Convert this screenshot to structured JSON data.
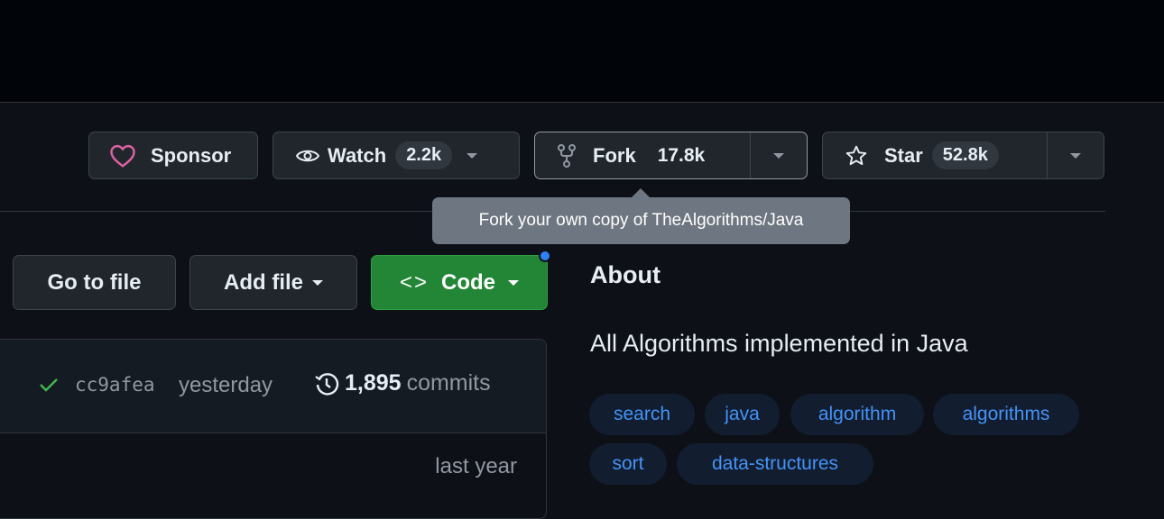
{
  "actions": {
    "sponsor_label": "Sponsor",
    "watch_label": "Watch",
    "watch_count": "2.2k",
    "fork_label": "Fork",
    "fork_count": "17.8k",
    "star_label": "Star",
    "star_count": "52.8k"
  },
  "tooltip": {
    "text": "Fork your own copy of TheAlgorithms/Java"
  },
  "file_actions": {
    "go_to_file": "Go to file",
    "add_file": "Add file",
    "code": "Code"
  },
  "commit": {
    "hash": "cc9afea",
    "time": "yesterday",
    "count": "1,895",
    "commits_label": "commits",
    "row_time": "last year"
  },
  "about": {
    "title": "About",
    "description": "All Algorithms implemented in Java",
    "topics": [
      "search",
      "java",
      "algorithm",
      "algorithms",
      "sort",
      "data-structures"
    ]
  },
  "colors": {
    "accent_green": "#238636",
    "link_blue": "#4493f8",
    "sponsor_pink": "#db61a2",
    "check_green": "#3fb950"
  }
}
